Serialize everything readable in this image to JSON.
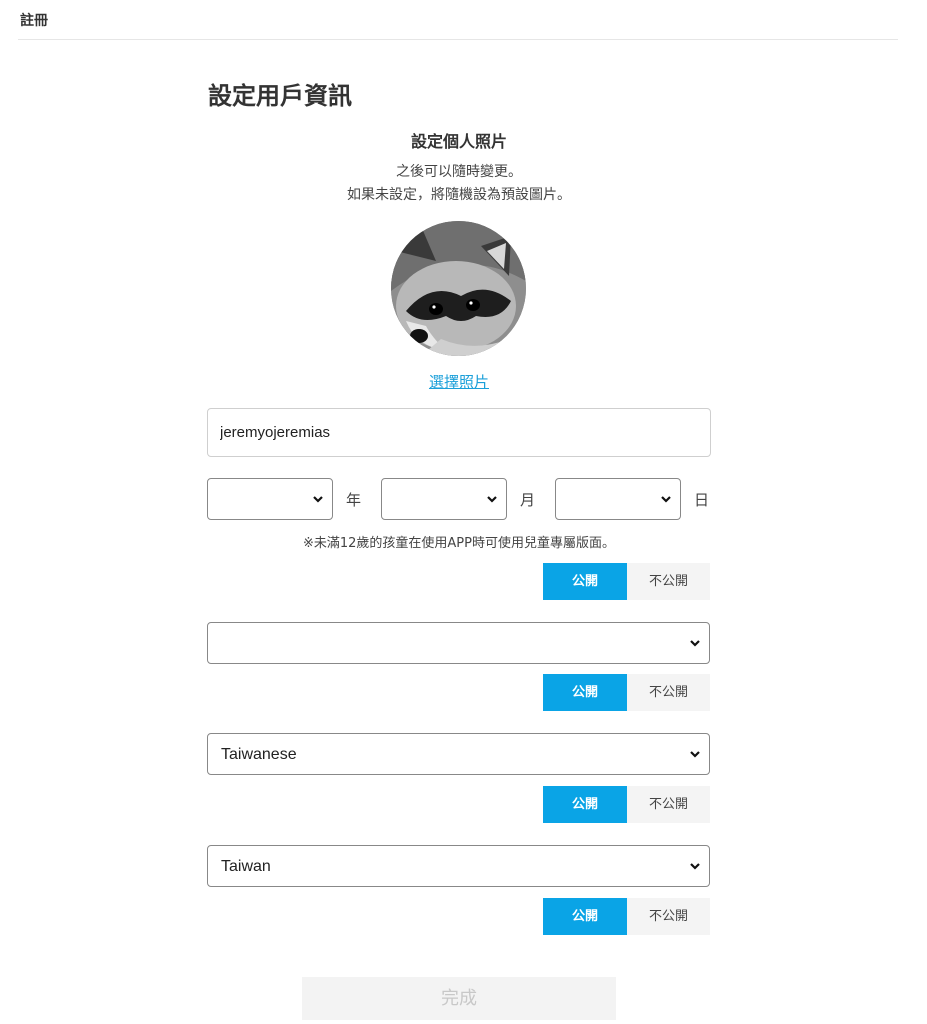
{
  "header": {
    "title": "註冊"
  },
  "page": {
    "title": "設定用戶資訊"
  },
  "photo": {
    "section_title": "設定個人照片",
    "hint_line1": "之後可以隨時變更。",
    "hint_line2": "如果未設定，將隨機設為預設圖片。",
    "avatar_icon": "raccoon-photo",
    "choose_link": "選擇照片"
  },
  "username": {
    "value": "jeremyojeremias"
  },
  "birthday": {
    "year": {
      "value": "",
      "unit": "年"
    },
    "month": {
      "value": "",
      "unit": "月"
    },
    "day": {
      "value": "",
      "unit": "日"
    },
    "note": "※未滿12歲的孩童在使用APP時可使用兒童專屬版面。"
  },
  "visibility": {
    "public_label": "公開",
    "private_label": "不公開"
  },
  "gender_select": {
    "value": ""
  },
  "language_select": {
    "value": "Taiwanese"
  },
  "region_select": {
    "value": "Taiwan"
  },
  "colors": {
    "accent": "#0aa4e6",
    "link": "#1a9fd9"
  },
  "footer": {
    "done_label": "完成"
  }
}
